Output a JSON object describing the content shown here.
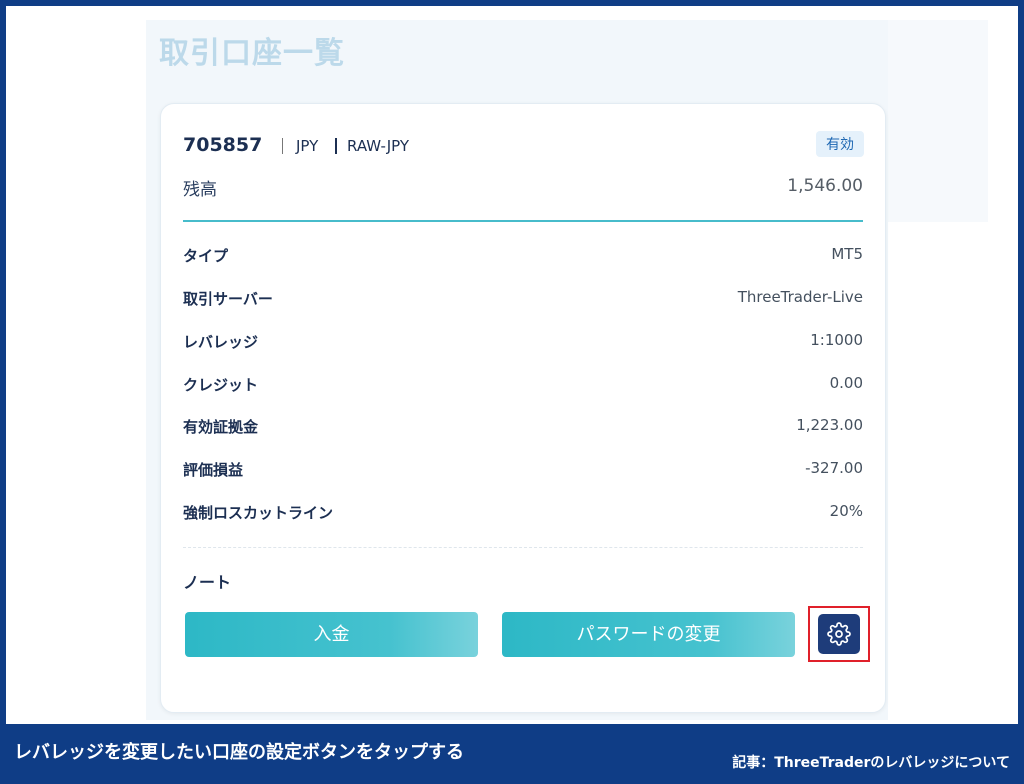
{
  "page": {
    "title": "取引口座一覧"
  },
  "account": {
    "number": "705857",
    "currency": "JPY",
    "group": "RAW-JPY",
    "status": "有効",
    "balance_label": "残高",
    "balance_value": "1,546.00"
  },
  "details": [
    {
      "label": "タイプ",
      "value": "MT5"
    },
    {
      "label": "取引サーバー",
      "value": "ThreeTrader-Live"
    },
    {
      "label": "レバレッジ",
      "value": "1:1000"
    },
    {
      "label": "クレジット",
      "value": "0.00"
    },
    {
      "label": "有効証拠金",
      "value": "1,223.00"
    },
    {
      "label": "評価損益",
      "value": "-327.00"
    },
    {
      "label": "強制ロスカットライン",
      "value": "20%"
    }
  ],
  "note": {
    "label": "ノート"
  },
  "actions": {
    "deposit_label": "入金",
    "change_password_label": "パスワードの変更",
    "settings_icon": "gear-icon"
  },
  "footer": {
    "caption": "レバレッジを変更したい口座の設定ボタンをタップする",
    "article": "記事：ThreeTraderのレバレッジについて"
  },
  "colors": {
    "accent": "#47bccb",
    "button": "#2db8c6",
    "settings_button": "#1e3c7a",
    "highlight": "#e0202a",
    "banner": "#0f3d86"
  }
}
